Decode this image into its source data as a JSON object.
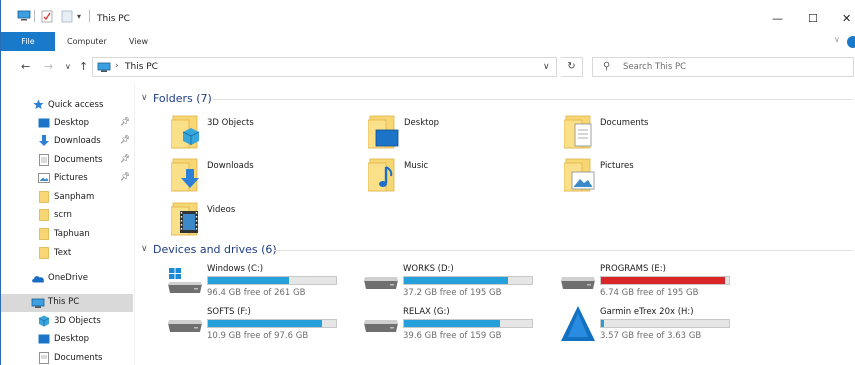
{
  "window": {
    "title": "This PC"
  },
  "ribbon": {
    "file_label": "File",
    "tabs": [
      "Computer",
      "View"
    ]
  },
  "address": {
    "location": "This PC",
    "search_placeholder": "Search This PC"
  },
  "sidebar": {
    "items": [
      {
        "label": "Quick access"
      },
      {
        "label": "Desktop"
      },
      {
        "label": "Downloads"
      },
      {
        "label": "Documents"
      },
      {
        "label": "Pictures"
      },
      {
        "label": "Sanpham"
      },
      {
        "label": "scrn"
      },
      {
        "label": "Taphuan"
      },
      {
        "label": "Text"
      },
      {
        "label": "OneDrive"
      },
      {
        "label": "This PC"
      },
      {
        "label": "3D Objects"
      },
      {
        "label": "Desktop"
      },
      {
        "label": "Documents"
      }
    ]
  },
  "folders": {
    "header": "Folders (7)",
    "items": [
      {
        "label": "3D Objects"
      },
      {
        "label": "Desktop"
      },
      {
        "label": "Documents"
      },
      {
        "label": "Downloads"
      },
      {
        "label": "Music"
      },
      {
        "label": "Pictures"
      },
      {
        "label": "Videos"
      }
    ]
  },
  "drives": {
    "header": "Devices and drives (6)",
    "items": [
      {
        "label": "Windows (C:)",
        "free_text": "96.4 GB free of 261 GB",
        "used_fraction": 0.63,
        "status_color": "#26a0da"
      },
      {
        "label": "WORKS (D:)",
        "free_text": "37.2 GB free of 195 GB",
        "used_fraction": 0.81,
        "status_color": "#26a0da"
      },
      {
        "label": "PROGRAMS (E:)",
        "free_text": "6.74 GB free of 195 GB",
        "used_fraction": 0.97,
        "status_color": "#da2626"
      },
      {
        "label": "SOFTS (F:)",
        "free_text": "10.9 GB free of 97.6 GB",
        "used_fraction": 0.89,
        "status_color": "#26a0da"
      },
      {
        "label": "RELAX (G:)",
        "free_text": "39.6 GB free of 159 GB",
        "used_fraction": 0.75,
        "status_color": "#26a0da"
      },
      {
        "label": "Garmin eTrex 20x (H:)",
        "free_text": "3.57 GB free of 3.63 GB",
        "used_fraction": 0.02,
        "status_color": "#26a0da"
      }
    ]
  }
}
